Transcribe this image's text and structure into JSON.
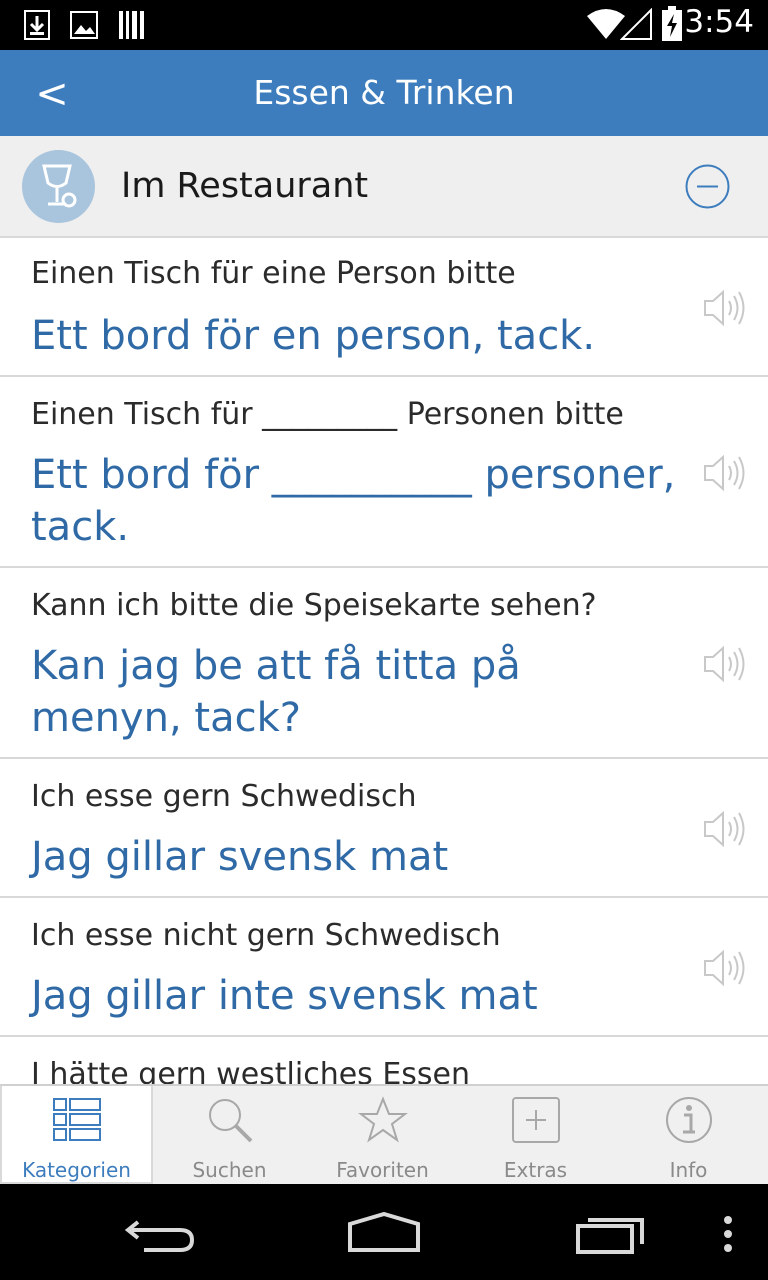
{
  "status_bar": {
    "time": "3:54",
    "icons": [
      "download-icon",
      "image-icon",
      "barcode-icon",
      "wifi-icon",
      "signal-icon",
      "battery-charging-icon"
    ]
  },
  "header": {
    "back_label": "<",
    "title": "Essen & Trinken"
  },
  "section": {
    "title": "Im Restaurant",
    "icon": "wine-glass-icon",
    "toggle_icon": "minus-circle-icon"
  },
  "phrases": [
    {
      "de": "Einen Tisch für eine Person bitte",
      "sv": "Ett bord för en person, tack."
    },
    {
      "de": "Einen Tisch für _________ Personen bitte",
      "sv": "Ett bord för __________ personer, tack."
    },
    {
      "de": "Kann ich bitte die Speisekarte sehen?",
      "sv": "Kan jag be att få titta på menyn, tack?"
    },
    {
      "de": "Ich esse gern Schwedisch",
      "sv": "Jag gillar svensk mat"
    },
    {
      "de": "Ich esse nicht gern Schwedisch",
      "sv": "Jag gillar inte svensk mat"
    },
    {
      "de": "I hätte gern westliches Essen",
      "sv": ""
    }
  ],
  "tabs": [
    {
      "label": "Kategorien",
      "icon": "list-icon",
      "active": true
    },
    {
      "label": "Suchen",
      "icon": "search-icon",
      "active": false
    },
    {
      "label": "Favoriten",
      "icon": "star-icon",
      "active": false
    },
    {
      "label": "Extras",
      "icon": "plus-box-icon",
      "active": false
    },
    {
      "label": "Info",
      "icon": "info-icon",
      "active": false
    }
  ],
  "nav_bar": {
    "buttons": [
      "back-icon",
      "home-icon",
      "recents-icon",
      "overflow-menu-icon"
    ]
  },
  "colors": {
    "accent": "#3d7dbe",
    "swedish_text": "#2f6aa6",
    "inactive": "#8a8a8a"
  }
}
